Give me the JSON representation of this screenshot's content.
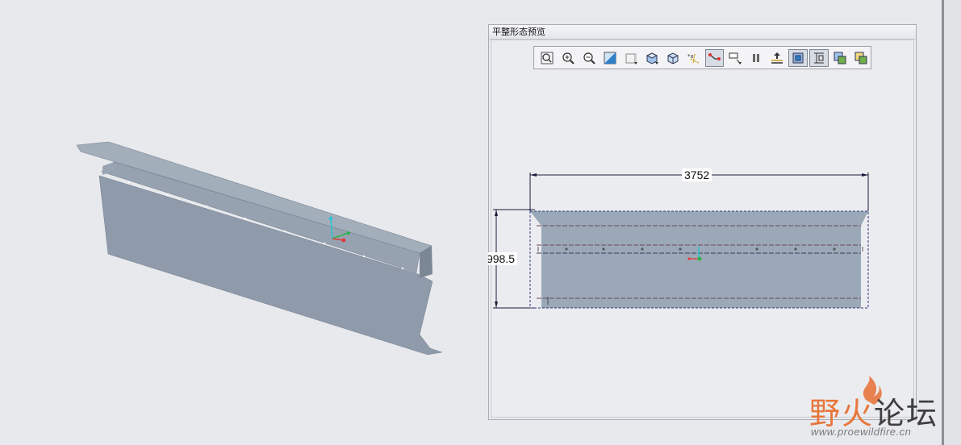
{
  "panel": {
    "title": "平整形态预览"
  },
  "toolbar": {
    "buttons": [
      {
        "name": "refit-icon",
        "active": false
      },
      {
        "name": "zoom-in-icon",
        "active": false
      },
      {
        "name": "zoom-out-icon",
        "active": false
      },
      {
        "name": "repaint-icon",
        "active": false
      },
      {
        "name": "display-style-icon",
        "active": false
      },
      {
        "name": "saved-orientations-icon",
        "active": false
      },
      {
        "name": "named-views-icon",
        "active": false
      },
      {
        "name": "datum-display-icon",
        "active": false
      },
      {
        "name": "csys-display-icon",
        "active": true
      },
      {
        "name": "annotation-display-icon",
        "active": false
      },
      {
        "name": "pause-icon",
        "active": false
      },
      {
        "name": "regenerate-icon",
        "active": false
      },
      {
        "name": "flat-pattern-toggle-icon",
        "active": true
      },
      {
        "name": "dimension-display-icon",
        "active": true
      },
      {
        "name": "copy-settings-icon",
        "active": false
      },
      {
        "name": "paste-settings-icon",
        "active": false
      }
    ]
  },
  "flat_pattern": {
    "width_dim": "3752",
    "height_dim": "998.5"
  },
  "watermark": {
    "brand_a": "野火",
    "brand_b": "论坛",
    "url": "www.proewildfire.cn"
  },
  "colors": {
    "model_fill": "#8e9aaa",
    "flat_fill": "#9ba8b7",
    "dim_line": "#1a1a3a",
    "bend_line": "#6a4a5a"
  }
}
